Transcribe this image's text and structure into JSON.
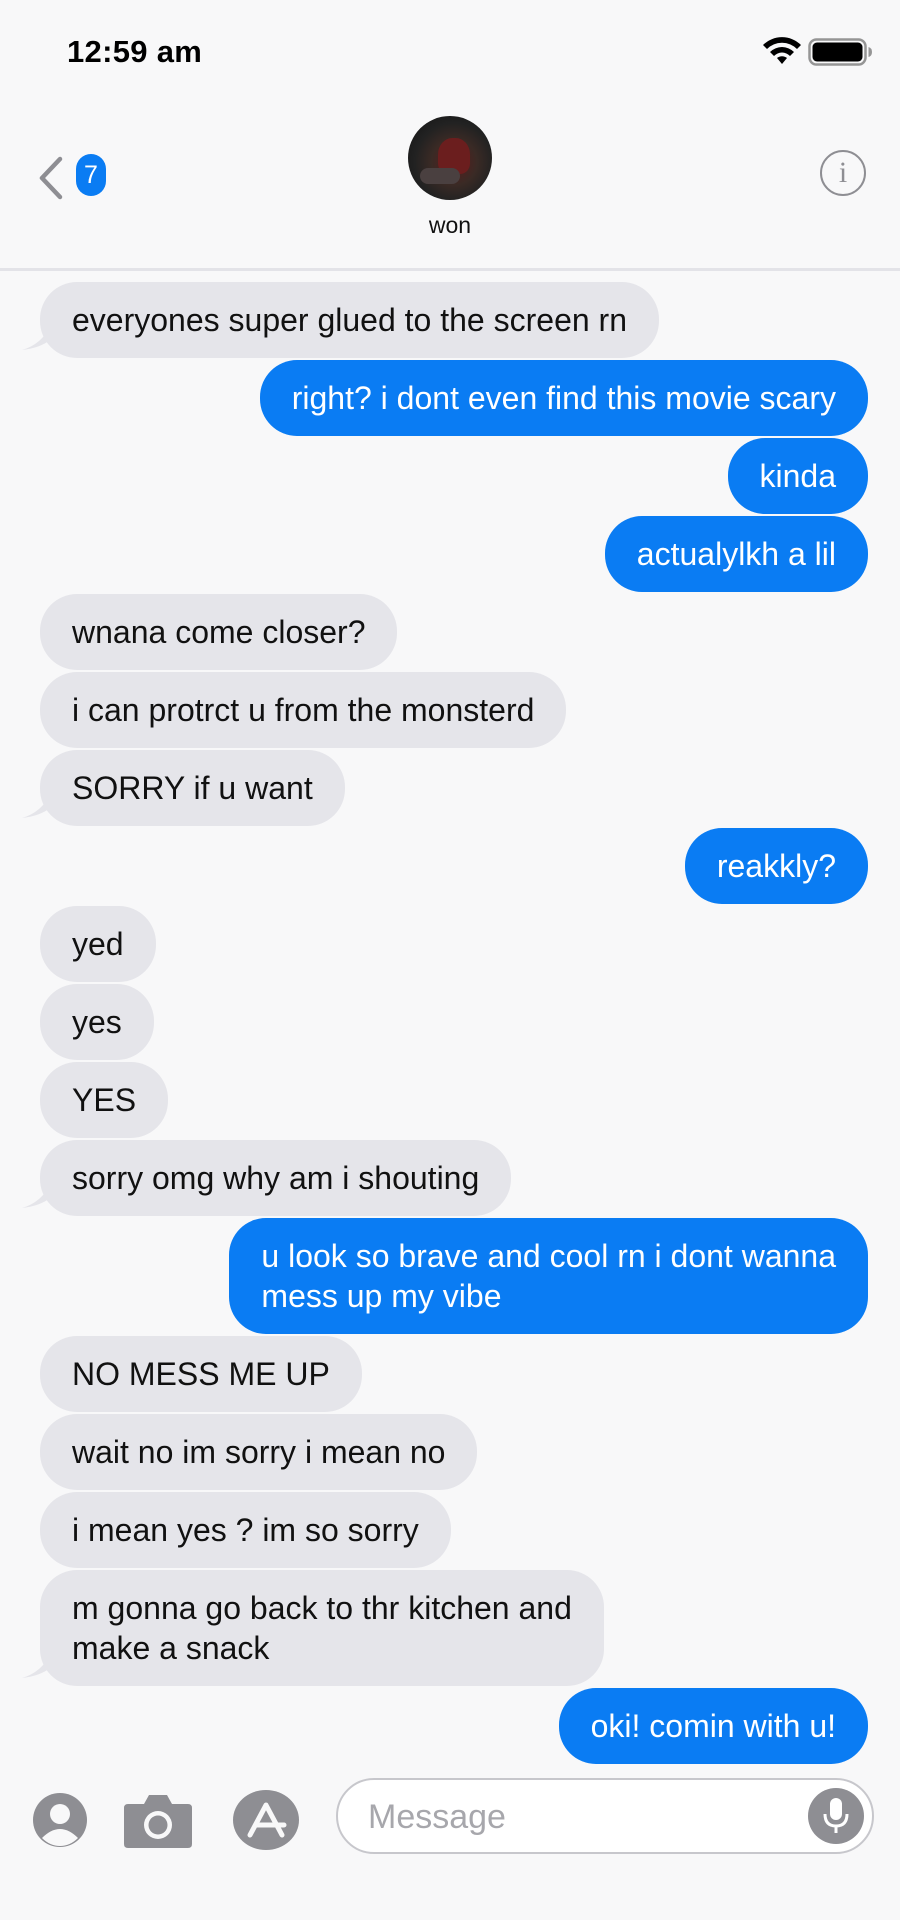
{
  "status_bar": {
    "time": "12:59 am"
  },
  "header": {
    "unread_count": "7",
    "contact_name": "won",
    "info_label": "i"
  },
  "messages": [
    {
      "from": "them",
      "text": "everyones super glued to the screen rn"
    },
    {
      "from": "me",
      "text": "right? i dont even find this movie scary"
    },
    {
      "from": "me",
      "text": "kinda"
    },
    {
      "from": "me",
      "text": "actualylkh a lil"
    },
    {
      "from": "them",
      "text": "wnana come closer?"
    },
    {
      "from": "them",
      "text": "i can protrct u from the monsterd"
    },
    {
      "from": "them",
      "text": "SORRY if u want"
    },
    {
      "from": "me",
      "text": "reakkly?"
    },
    {
      "from": "them",
      "text": "yed"
    },
    {
      "from": "them",
      "text": "yes"
    },
    {
      "from": "them",
      "text": "YES"
    },
    {
      "from": "them",
      "text": "sorry omg why am i shouting"
    },
    {
      "from": "me",
      "text": "u look so brave and cool rn i dont wanna",
      "text_line2": "mess up my vibe"
    },
    {
      "from": "them",
      "text": "NO MESS ME UP"
    },
    {
      "from": "them",
      "text": "wait no im sorry i mean no"
    },
    {
      "from": "them",
      "text": "i mean yes ? im so sorry"
    },
    {
      "from": "them",
      "text": "m gonna go back to thr kitchen and",
      "text_line2": "make a snack"
    },
    {
      "from": "me",
      "text": "oki! comin with u!"
    }
  ],
  "input_bar": {
    "placeholder": "Message"
  },
  "colors": {
    "sent_bubble": "#0a7cf3",
    "received_bubble": "#e5e5ea",
    "background": "#f8f8f9"
  },
  "icons": {
    "status": [
      "wifi-icon",
      "battery-icon"
    ],
    "header": [
      "chevron-left-icon",
      "info-icon"
    ],
    "input": [
      "apps-icon",
      "camera-icon",
      "app-store-icon",
      "microphone-icon"
    ]
  }
}
